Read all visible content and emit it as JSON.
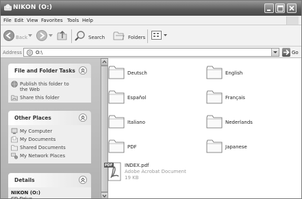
{
  "window": {
    "title": "NIKON (O:)"
  },
  "menu": [
    "File",
    "Edit",
    "View",
    "Favorites",
    "Tools",
    "Help"
  ],
  "toolbar": {
    "back_label": "Back",
    "search_label": "Search",
    "folders_label": "Folders"
  },
  "address": {
    "label": "Address",
    "value": "O:\\",
    "go_label": "Go"
  },
  "left_panels": {
    "file_tasks": {
      "title": "File and Folder Tasks",
      "items": [
        "Publish this folder to the Web",
        "Share this folder"
      ]
    },
    "other_places": {
      "title": "Other Places",
      "items": [
        "My Computer",
        "My Documents",
        "Shared Documents",
        "My Network Places"
      ]
    },
    "details": {
      "title": "Details",
      "name": "NIKON (O:)",
      "type": "CD Drive"
    }
  },
  "folders": [
    "Deutsch",
    "English",
    "Español",
    "Français",
    "Italiano",
    "Nederlands",
    "PDF",
    "Japanese"
  ],
  "file": {
    "name": "INDEX.pdf",
    "type": "Adobe Acrobat Document",
    "size": "19 KB",
    "badge": "PDF"
  },
  "icons": [
    "drive-icon",
    "minimize-icon",
    "maximize-icon",
    "close-icon",
    "back-icon",
    "forward-icon",
    "up-folder-icon",
    "search-icon",
    "folders-icon",
    "views-icon",
    "go-icon",
    "folder-icon",
    "pdf-icon"
  ]
}
